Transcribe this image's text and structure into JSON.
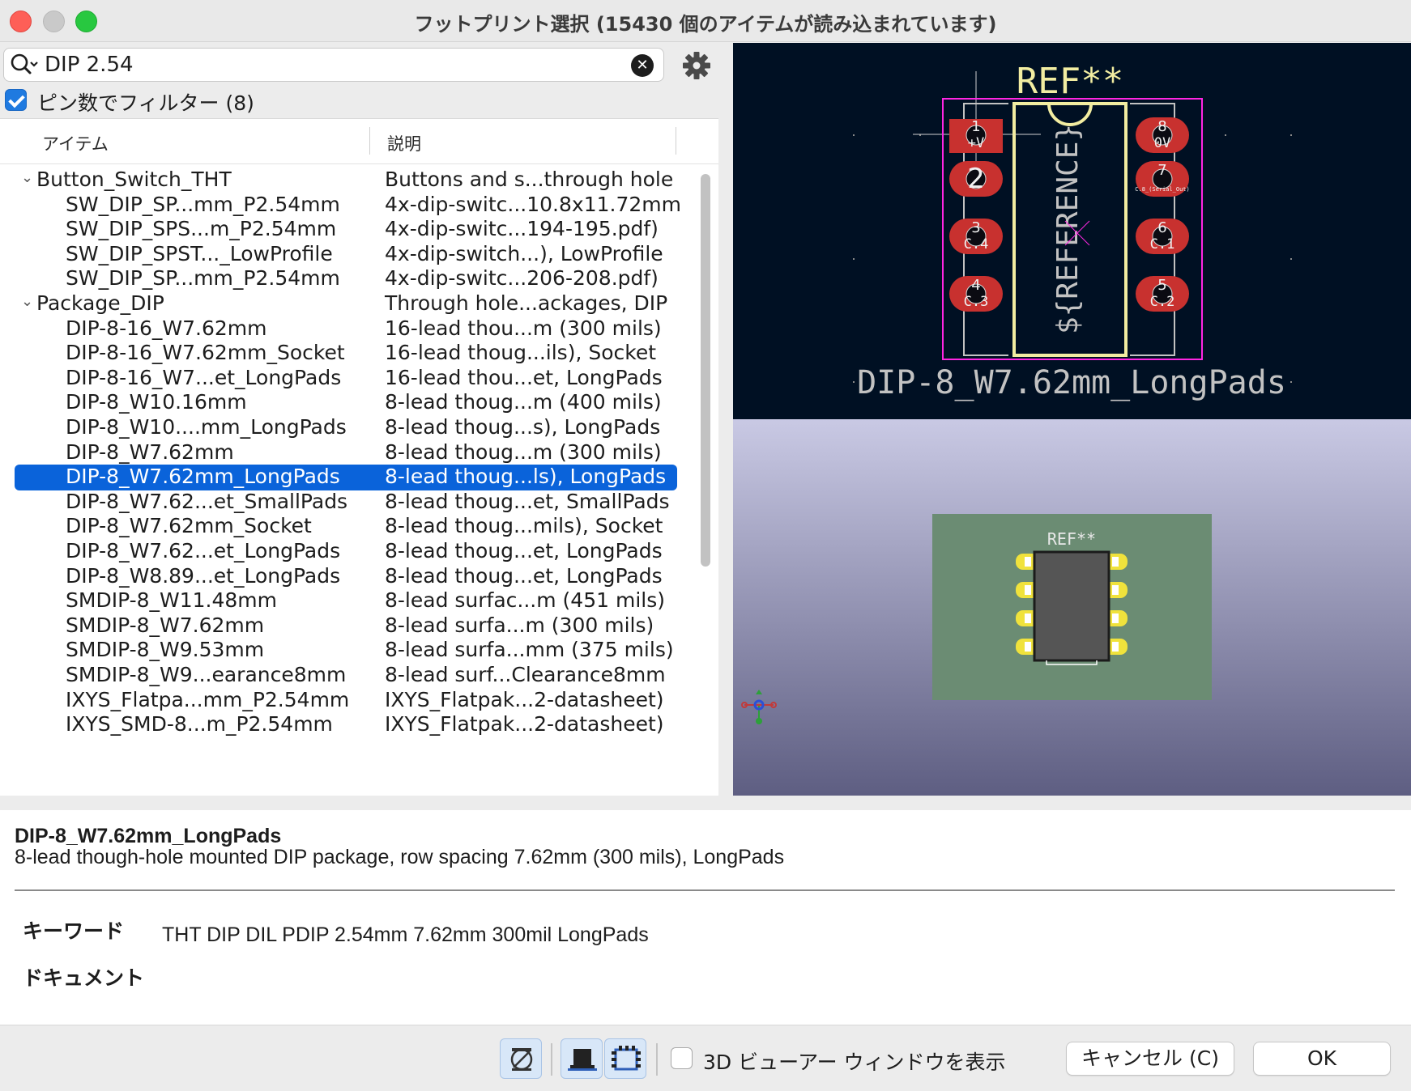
{
  "window": {
    "title": "フットプリント選択 (15430 個のアイテムが読み込まれています)"
  },
  "search": {
    "value": "DIP 2.54",
    "icon": "search-icon",
    "clear_icon": "clear-icon"
  },
  "settings": {
    "icon": "gear-icon"
  },
  "filter": {
    "checked": true,
    "label": "ピン数でフィルター (8)"
  },
  "columns": {
    "item": "アイテム",
    "description": "説明"
  },
  "tree": {
    "rows": [
      {
        "depth": 0,
        "expanded": true,
        "name": "Button_Switch_THT",
        "desc": "Buttons and s...through hole"
      },
      {
        "depth": 1,
        "name": "SW_DIP_SP...mm_P2.54mm",
        "desc": "4x-dip-switc...10.8x11.72mm"
      },
      {
        "depth": 1,
        "name": "SW_DIP_SPS...m_P2.54mm",
        "desc": "4x-dip-switc...194-195.pdf)"
      },
      {
        "depth": 1,
        "name": "SW_DIP_SPST..._LowProfile",
        "desc": "4x-dip-switch...), LowProfile"
      },
      {
        "depth": 1,
        "name": "SW_DIP_SP...mm_P2.54mm",
        "desc": "4x-dip-switc...206-208.pdf)"
      },
      {
        "depth": 0,
        "expanded": true,
        "name": "Package_DIP",
        "desc": "Through hole...ackages, DIP"
      },
      {
        "depth": 1,
        "name": "DIP-8-16_W7.62mm",
        "desc": "16-lead thou...m (300 mils)"
      },
      {
        "depth": 1,
        "name": "DIP-8-16_W7.62mm_Socket",
        "desc": "16-lead thoug...ils), Socket"
      },
      {
        "depth": 1,
        "name": "DIP-8-16_W7...et_LongPads",
        "desc": "16-lead thou...et, LongPads"
      },
      {
        "depth": 1,
        "name": "DIP-8_W10.16mm",
        "desc": "8-lead thoug...m (400 mils)"
      },
      {
        "depth": 1,
        "name": "DIP-8_W10....mm_LongPads",
        "desc": "8-lead thoug...s), LongPads"
      },
      {
        "depth": 1,
        "name": "DIP-8_W7.62mm",
        "desc": "8-lead thoug...m (300 mils)"
      },
      {
        "depth": 1,
        "selected": true,
        "name": "DIP-8_W7.62mm_LongPads",
        "desc": "8-lead thoug...ls), LongPads"
      },
      {
        "depth": 1,
        "name": "DIP-8_W7.62...et_SmallPads",
        "desc": "8-lead thoug...et, SmallPads"
      },
      {
        "depth": 1,
        "name": "DIP-8_W7.62mm_Socket",
        "desc": "8-lead thoug...mils), Socket"
      },
      {
        "depth": 1,
        "name": "DIP-8_W7.62...et_LongPads",
        "desc": "8-lead thoug...et, LongPads"
      },
      {
        "depth": 1,
        "name": "DIP-8_W8.89...et_LongPads",
        "desc": "8-lead thoug...et, LongPads"
      },
      {
        "depth": 1,
        "name": "SMDIP-8_W11.48mm",
        "desc": "8-lead surfac...m (451 mils)"
      },
      {
        "depth": 1,
        "name": "SMDIP-8_W7.62mm",
        "desc": "8-lead surfa...m (300 mils)"
      },
      {
        "depth": 1,
        "name": "SMDIP-8_W9.53mm",
        "desc": "8-lead surfa...mm (375 mils)"
      },
      {
        "depth": 1,
        "name": "SMDIP-8_W9...earance8mm",
        "desc": "8-lead surf...Clearance8mm"
      },
      {
        "depth": 1,
        "name": "IXYS_Flatpa...mm_P2.54mm",
        "desc": "IXYS_Flatpak...2-datasheet)"
      },
      {
        "depth": 1,
        "name": "IXYS_SMD-8...m_P2.54mm",
        "desc": "IXYS_Flatpak...2-datasheet)"
      }
    ]
  },
  "footprint_preview": {
    "ref": "REF**",
    "value_text": "DIP-8_W7.62mm_LongPads",
    "reference_text": "${REFERENCE}",
    "pads_left": [
      {
        "num": "1",
        "net": "+V"
      },
      {
        "num": "2",
        "net": ""
      },
      {
        "num": "3",
        "net": "C.4"
      },
      {
        "num": "4",
        "net": "C.3"
      }
    ],
    "pads_right": [
      {
        "num": "8",
        "net": "0V"
      },
      {
        "num": "7",
        "net": "C.8_(Serial_Out)"
      },
      {
        "num": "6",
        "net": "C.1"
      },
      {
        "num": "5",
        "net": "C.2"
      }
    ],
    "colors": {
      "background": "#001023",
      "pad": "#c8312f",
      "silk": "#f2eda1",
      "courtyard": "#ff26e2",
      "fab": "#c2c2c2"
    }
  },
  "view3d": {
    "ref": "REF**",
    "board_color": "#6b8c73"
  },
  "details": {
    "name": "DIP-8_W7.62mm_LongPads",
    "description": "8-lead though-hole mounted DIP package, row spacing 7.62mm (300 mils), LongPads",
    "keywords_label": "キーワード",
    "keywords": "THT DIP DIL PDIP 2.54mm 7.62mm 300mil LongPads",
    "doc_label": "ドキュメント"
  },
  "footer": {
    "show_3d_label": "3D ビューアー ウィンドウを表示",
    "show_3d_checked": false,
    "cancel": "キャンセル (C)",
    "ok": "OK"
  }
}
